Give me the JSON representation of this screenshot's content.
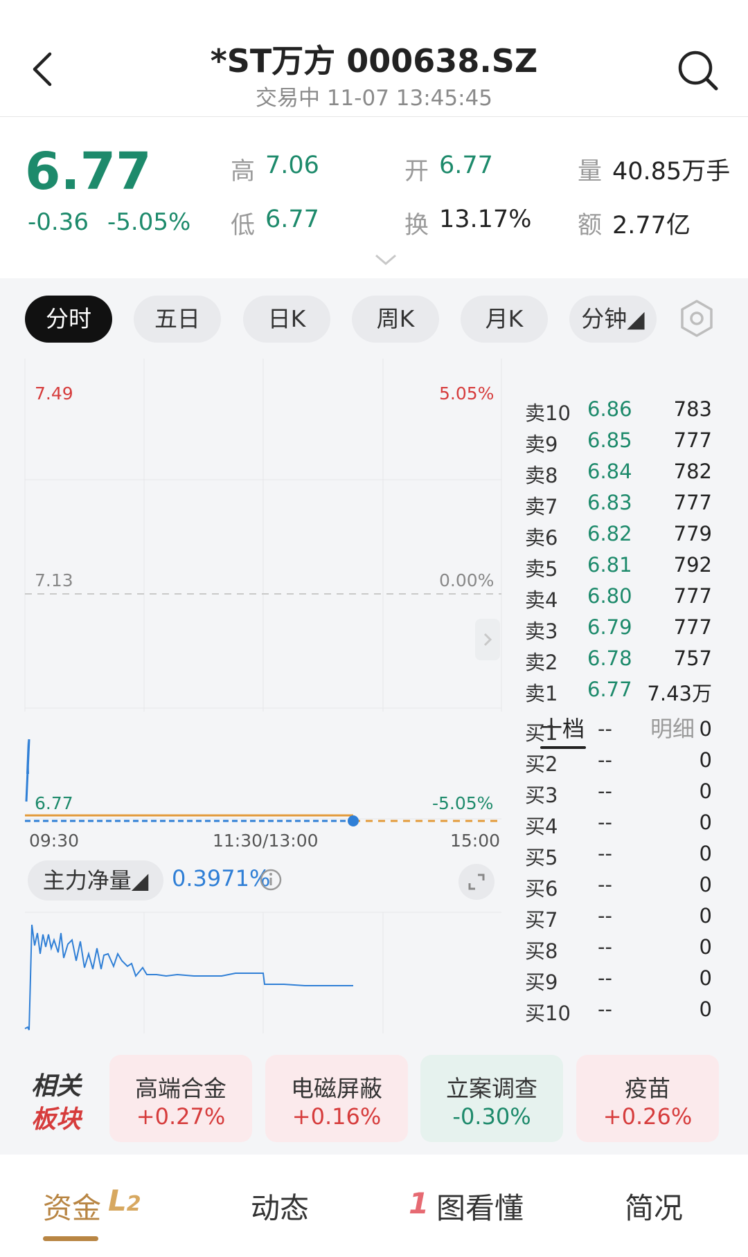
{
  "header": {
    "title": "*ST万方 000638.SZ",
    "subtitle": "交易中 11-07 13:45:45"
  },
  "quote": {
    "price": "6.77",
    "change": "-0.36",
    "change_pct": "-5.05%",
    "high_label": "高",
    "high": "7.06",
    "low_label": "低",
    "low": "6.77",
    "open_label": "开",
    "open": "6.77",
    "turnover_label": "换",
    "turnover": "13.17%",
    "volume_label": "量",
    "volume": "40.85万手",
    "amount_label": "额",
    "amount": "2.77亿"
  },
  "tabs": [
    {
      "label": "分时",
      "active": true
    },
    {
      "label": "五日",
      "active": false
    },
    {
      "label": "日K",
      "active": false
    },
    {
      "label": "周K",
      "active": false
    },
    {
      "label": "月K",
      "active": false
    },
    {
      "label": "分钟◢",
      "active": false
    }
  ],
  "chart": {
    "y_top": "7.49",
    "pct_top": "5.05%",
    "y_mid": "7.13",
    "pct_mid": "0.00%",
    "y_bottom": "6.77",
    "pct_bottom": "-5.05%",
    "x_start": "09:30",
    "x_mid": "11:30/13:00",
    "x_end": "15:00"
  },
  "chart_data": {
    "type": "line",
    "title": "",
    "xlabel": "",
    "ylabel": "",
    "x_ticks": [
      "09:30",
      "11:30/13:00",
      "15:00"
    ],
    "ylim": [
      6.77,
      7.49
    ],
    "y_ticks": [
      6.77,
      7.13,
      7.49
    ],
    "pct_ticks": [
      "-5.05%",
      "0.00%",
      "5.05%"
    ],
    "prev_close": 7.13,
    "series": [
      {
        "values": [
          6.77,
          6.77,
          6.77,
          6.77,
          6.77,
          6.77,
          6.77,
          6.77,
          6.77,
          6.77,
          6.77
        ],
        "x": [
          0,
          18,
          36,
          54,
          72,
          90,
          108,
          126,
          144,
          162,
          174
        ]
      }
    ],
    "volume_spike_at_open": true,
    "net_flow_indicator": {
      "label": "主力净量",
      "value": "0.3971%"
    }
  },
  "indicator": {
    "label": "主力净量◢",
    "value": "0.3971%"
  },
  "order_book": {
    "tab_ten": "十档",
    "tab_detail": "明细",
    "asks": [
      {
        "label": "卖10",
        "price": "6.86",
        "vol": "783"
      },
      {
        "label": "卖9",
        "price": "6.85",
        "vol": "777"
      },
      {
        "label": "卖8",
        "price": "6.84",
        "vol": "782"
      },
      {
        "label": "卖7",
        "price": "6.83",
        "vol": "777"
      },
      {
        "label": "卖6",
        "price": "6.82",
        "vol": "779"
      },
      {
        "label": "卖5",
        "price": "6.81",
        "vol": "792"
      },
      {
        "label": "卖4",
        "price": "6.80",
        "vol": "777"
      },
      {
        "label": "卖3",
        "price": "6.79",
        "vol": "777"
      },
      {
        "label": "卖2",
        "price": "6.78",
        "vol": "757"
      },
      {
        "label": "卖1",
        "price": "6.77",
        "vol": "7.43万"
      }
    ],
    "bids": [
      {
        "label": "买1",
        "price": "--",
        "vol": "0"
      },
      {
        "label": "买2",
        "price": "--",
        "vol": "0"
      },
      {
        "label": "买3",
        "price": "--",
        "vol": "0"
      },
      {
        "label": "买4",
        "price": "--",
        "vol": "0"
      },
      {
        "label": "买5",
        "price": "--",
        "vol": "0"
      },
      {
        "label": "买6",
        "price": "--",
        "vol": "0"
      },
      {
        "label": "买7",
        "price": "--",
        "vol": "0"
      },
      {
        "label": "买8",
        "price": "--",
        "vol": "0"
      },
      {
        "label": "买9",
        "price": "--",
        "vol": "0"
      },
      {
        "label": "买10",
        "price": "--",
        "vol": "0"
      }
    ]
  },
  "sectors": {
    "title_line1": "相关",
    "title_line2": "板块",
    "items": [
      {
        "name": "高端合金",
        "change": "+0.27%",
        "dir": "up"
      },
      {
        "name": "电磁屏蔽",
        "change": "+0.16%",
        "dir": "up"
      },
      {
        "name": "立案调查",
        "change": "-0.30%",
        "dir": "down"
      },
      {
        "name": "疫苗",
        "change": "+0.26%",
        "dir": "up"
      }
    ]
  },
  "bottom_nav": {
    "funds": "资金",
    "funds_badge_l": "L",
    "funds_badge_2": "2",
    "dynamics": "动态",
    "diagram_mark": "1",
    "diagram": "图看懂",
    "profile": "简况"
  },
  "colors": {
    "down_green": "#1d8a6b",
    "up_red": "#d63c3c",
    "price_line": "#2f7fd6",
    "avg_line": "#e39a3a",
    "accent_gold": "#b88543"
  }
}
